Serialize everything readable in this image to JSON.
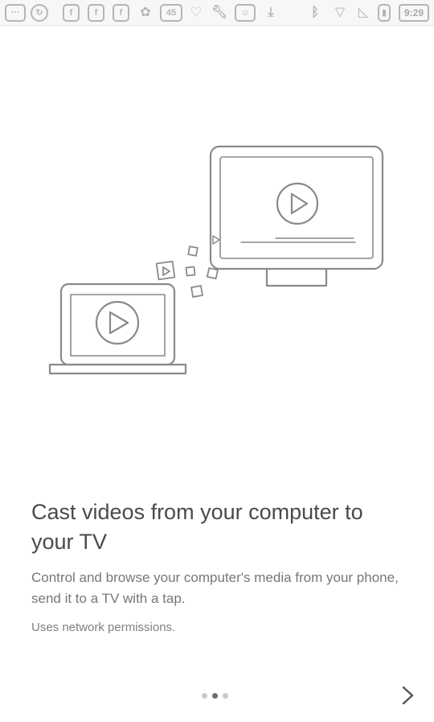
{
  "status_bar": {
    "time": "9:29",
    "notification_count": "45"
  },
  "onboarding": {
    "headline": "Cast videos from your computer to your TV",
    "description": "Control and browse your computer's media from your phone, send it to a TV with a tap.",
    "permissions_note": "Uses network permissions.",
    "current_page": 2,
    "total_pages": 3
  },
  "icons": {
    "next": "chevron-right-icon",
    "illustration": "laptop-to-tv-cast-illustration"
  },
  "colors": {
    "line_art": "#8a8a8a",
    "headline": "#4a4a4a",
    "body": "#777777",
    "dot_active": "#6f6f6f",
    "dot_inactive": "#c9c9c9"
  }
}
